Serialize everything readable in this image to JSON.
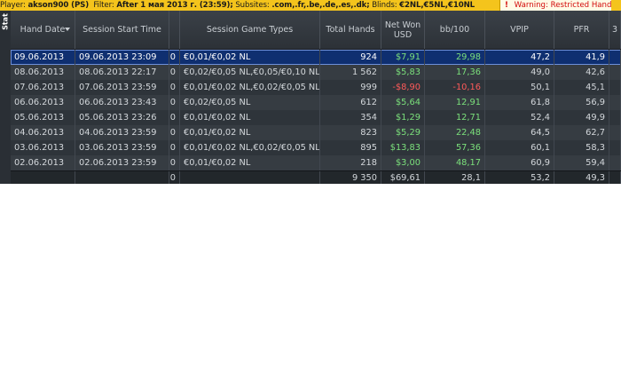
{
  "filter_bar": {
    "player_label": "Player:",
    "player_value": "akson900 (PS)",
    "filter_label": "Filter:",
    "filter_value": "After 1 мая 2013 г. (23:59);",
    "subsites_label": "Subsites:",
    "subsites_value": ".com,.fr,.be,.de,.es,.dk;",
    "blinds_label": "Blinds:",
    "blinds_value": "€2NL,€5NL,€10NL",
    "warning_icon": "exclamation-icon",
    "warning_text": "Warning: Restricted Hand"
  },
  "stat_tab": {
    "label": "Stat"
  },
  "columns": [
    {
      "key": "hand_date",
      "label": "Hand Date",
      "sorted": "desc"
    },
    {
      "key": "session_start",
      "label": "Session Start Time"
    },
    {
      "key": "c3",
      "label": ""
    },
    {
      "key": "game_types",
      "label": "Session Game Types"
    },
    {
      "key": "total_hands",
      "label": "Total Hands"
    },
    {
      "key": "net_won",
      "label": "Net Won USD"
    },
    {
      "key": "bb100",
      "label": "bb/100"
    },
    {
      "key": "vpip",
      "label": "VPIP"
    },
    {
      "key": "pfr",
      "label": "PFR"
    },
    {
      "key": "c10",
      "label": "3"
    }
  ],
  "rows": [
    {
      "hand_date": "09.06.2013",
      "session_start": "09.06.2013 23:09",
      "c3": "0",
      "game_types": "€0,01/€0,02 NL",
      "total_hands": "924",
      "net_won": "$7,91",
      "bb100": "29,98",
      "vpip": "47,2",
      "pfr": "41,9",
      "net_sign": "pos",
      "selected": true
    },
    {
      "hand_date": "08.06.2013",
      "session_start": "08.06.2013 22:17",
      "c3": "0",
      "game_types": "€0,02/€0,05 NL,€0,05/€0,10 NL",
      "total_hands": "1 562",
      "net_won": "$5,83",
      "bb100": "17,36",
      "vpip": "49,0",
      "pfr": "42,6",
      "net_sign": "pos",
      "selected": false
    },
    {
      "hand_date": "07.06.2013",
      "session_start": "07.06.2013 23:59",
      "c3": "0",
      "game_types": "€0,01/€0,02 NL,€0,02/€0,05 NL",
      "total_hands": "999",
      "net_won": "-$8,90",
      "bb100": "-10,16",
      "vpip": "50,1",
      "pfr": "45,1",
      "net_sign": "neg",
      "selected": false
    },
    {
      "hand_date": "06.06.2013",
      "session_start": "06.06.2013 23:43",
      "c3": "0",
      "game_types": "€0,02/€0,05 NL",
      "total_hands": "612",
      "net_won": "$5,64",
      "bb100": "12,91",
      "vpip": "61,8",
      "pfr": "56,9",
      "net_sign": "pos",
      "selected": false
    },
    {
      "hand_date": "05.06.2013",
      "session_start": "05.06.2013 23:26",
      "c3": "0",
      "game_types": "€0,01/€0,02 NL",
      "total_hands": "354",
      "net_won": "$1,29",
      "bb100": "12,71",
      "vpip": "52,4",
      "pfr": "49,9",
      "net_sign": "pos",
      "selected": false
    },
    {
      "hand_date": "04.06.2013",
      "session_start": "04.06.2013 23:59",
      "c3": "0",
      "game_types": "€0,01/€0,02 NL",
      "total_hands": "823",
      "net_won": "$5,29",
      "bb100": "22,48",
      "vpip": "64,5",
      "pfr": "62,7",
      "net_sign": "pos",
      "selected": false
    },
    {
      "hand_date": "03.06.2013",
      "session_start": "03.06.2013 23:59",
      "c3": "0",
      "game_types": "€0,01/€0,02 NL,€0,02/€0,05 NL",
      "total_hands": "895",
      "net_won": "$13,83",
      "bb100": "57,36",
      "vpip": "60,1",
      "pfr": "58,3",
      "net_sign": "pos",
      "selected": false
    },
    {
      "hand_date": "02.06.2013",
      "session_start": "02.06.2013 23:59",
      "c3": "0",
      "game_types": "€0,01/€0,02 NL",
      "total_hands": "218",
      "net_won": "$3,00",
      "bb100": "48,17",
      "vpip": "60,9",
      "pfr": "59,4",
      "net_sign": "pos",
      "selected": false
    }
  ],
  "totals": {
    "hand_date": "",
    "session_start": "",
    "c3": "0",
    "game_types": "",
    "total_hands": "9 350",
    "net_won": "$69,61",
    "bb100": "28,1",
    "vpip": "53,2",
    "pfr": "49,3"
  },
  "colors": {
    "positive": "#7be07b",
    "negative": "#ff5a5a",
    "selection": "#0f2f70",
    "filter_bar": "#f4c41c"
  }
}
